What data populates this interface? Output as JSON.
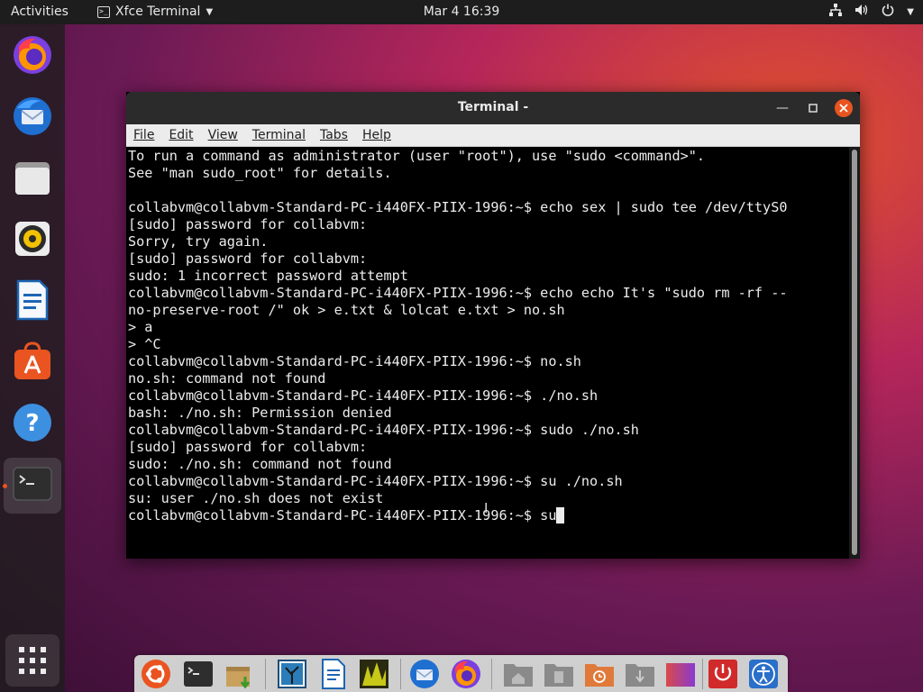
{
  "topbar": {
    "activities": "Activities",
    "app_name": "Xfce Terminal",
    "clock": "Mar 4  16:39"
  },
  "dock": {
    "items": [
      {
        "name": "firefox-icon"
      },
      {
        "name": "thunderbird-icon"
      },
      {
        "name": "files-icon"
      },
      {
        "name": "rhythmbox-icon"
      },
      {
        "name": "writer-icon"
      },
      {
        "name": "software-icon"
      },
      {
        "name": "help-icon"
      },
      {
        "name": "terminal-icon"
      }
    ]
  },
  "terminal": {
    "title": "Terminal -",
    "menu": [
      "File",
      "Edit",
      "View",
      "Terminal",
      "Tabs",
      "Help"
    ],
    "menu_underline_first": true,
    "lines": [
      "To run a command as administrator (user \"root\"), use \"sudo <command>\".",
      "See \"man sudo_root\" for details.",
      "",
      "collabvm@collabvm-Standard-PC-i440FX-PIIX-1996:~$ echo sex | sudo tee /dev/ttyS0",
      "[sudo] password for collabvm:",
      "Sorry, try again.",
      "[sudo] password for collabvm:",
      "sudo: 1 incorrect password attempt",
      "collabvm@collabvm-Standard-PC-i440FX-PIIX-1996:~$ echo echo It's \"sudo rm -rf --",
      "no-preserve-root /\" ok > e.txt & lolcat e.txt > no.sh",
      "> a",
      "> ^C",
      "collabvm@collabvm-Standard-PC-i440FX-PIIX-1996:~$ no.sh",
      "no.sh: command not found",
      "collabvm@collabvm-Standard-PC-i440FX-PIIX-1996:~$ ./no.sh",
      "bash: ./no.sh: Permission denied",
      "collabvm@collabvm-Standard-PC-i440FX-PIIX-1996:~$ sudo ./no.sh",
      "[sudo] password for collabvm:",
      "sudo: ./no.sh: command not found",
      "collabvm@collabvm-Standard-PC-i440FX-PIIX-1996:~$ su ./no.sh",
      "su: user ./no.sh does not exist"
    ],
    "prompt_line": "collabvm@collabvm-Standard-PC-i440FX-PIIX-1996:~$ su"
  },
  "taskbar": {
    "items": [
      {
        "name": "ubuntu-menu-icon"
      },
      {
        "name": "terminal-icon"
      },
      {
        "name": "package-icon"
      },
      {
        "name": "image-viewer-icon"
      },
      {
        "name": "document-icon"
      },
      {
        "name": "photo-icon"
      },
      {
        "name": "thunderbird-icon"
      },
      {
        "name": "firefox-icon"
      },
      {
        "name": "home-folder-icon"
      },
      {
        "name": "documents-folder-icon"
      },
      {
        "name": "recent-folder-icon"
      },
      {
        "name": "downloads-folder-icon"
      },
      {
        "name": "gradient-folder-icon"
      },
      {
        "name": "power-icon"
      },
      {
        "name": "accessibility-icon"
      }
    ]
  },
  "colors": {
    "accent": "#e95420",
    "terminal_bg": "#000000",
    "terminal_fg": "#ececec"
  }
}
